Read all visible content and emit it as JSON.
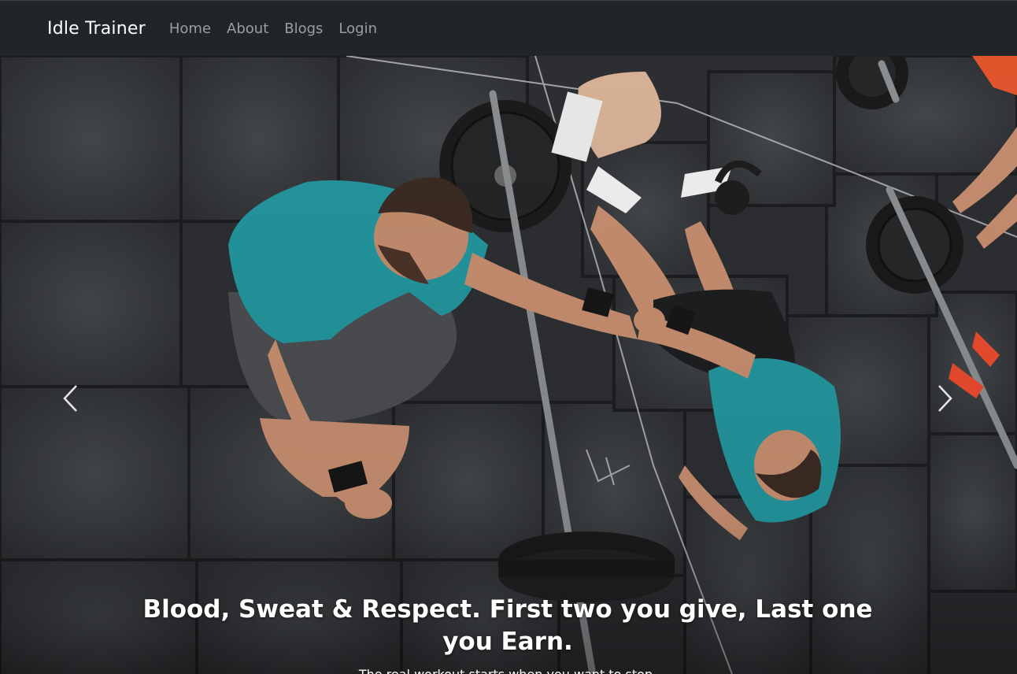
{
  "navbar": {
    "brand": "Idle Trainer",
    "links": [
      "Home",
      "About",
      "Blogs",
      "Login"
    ]
  },
  "hero": {
    "title": "Blood, Sweat & Respect. First two you give, Last one you Earn.",
    "subtitle": "The real workout starts when you want to stop.",
    "icons": {
      "prev": "chevron-left-icon",
      "next": "chevron-right-icon"
    }
  },
  "colors": {
    "navbar_bg": "#212529",
    "brand_text": "#ffffff",
    "nav_link_text": "rgba(255,255,255,0.55)",
    "shirt_teal": "#23939b",
    "floor_tile": "#2f3134"
  }
}
